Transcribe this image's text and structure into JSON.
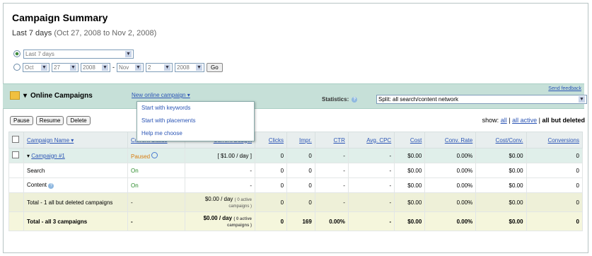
{
  "header": {
    "title": "Campaign Summary",
    "period": "Last 7 days",
    "range": "(Oct 27, 2008 to Nov 2, 2008)"
  },
  "date_filter": {
    "preset_value": "Last 7 days",
    "from_month": "Oct",
    "from_day": "27",
    "from_year": "2008",
    "to_month": "Nov",
    "to_day": "2",
    "to_year": "2008",
    "dash": "-",
    "go_label": "Go"
  },
  "campaigns_bar": {
    "label": "Online Campaigns",
    "new_campaign": "New online campaign ▾",
    "statistics_label": "Statistics:",
    "split_value": "Split: all search/content network",
    "feedback": "Send feedback"
  },
  "new_menu": {
    "items": [
      "Start with keywords",
      "Start with placements",
      "Help me choose"
    ]
  },
  "toolbar": {
    "pause": "Pause",
    "resume": "Resume",
    "delete": "Delete"
  },
  "show": {
    "label": "show:",
    "all": "all",
    "all_active": "all active",
    "all_but_deleted": "all but deleted",
    "sep": "|"
  },
  "table": {
    "headers": [
      "Campaign Name ▾",
      "Current Status",
      "Current Budget",
      "Clicks",
      "Impr.",
      "CTR",
      "Avg. CPC",
      "Cost",
      "Conv. Rate",
      "Cost/Conv.",
      "Conversions"
    ],
    "rows": [
      {
        "name": "Campaign #1",
        "status": "Paused",
        "budget": "[ $1.00 / day ]",
        "budget_sub": "",
        "clicks": "0",
        "impr": "0",
        "ctr": "-",
        "cpc": "-",
        "cost": "$0.00",
        "conv_rate": "0.00%",
        "cost_conv": "$0.00",
        "conversions": "0"
      },
      {
        "name": "Search",
        "status": "On",
        "budget": "-",
        "budget_sub": "",
        "clicks": "0",
        "impr": "0",
        "ctr": "-",
        "cpc": "-",
        "cost": "$0.00",
        "conv_rate": "0.00%",
        "cost_conv": "$0.00",
        "conversions": "0"
      },
      {
        "name": "Content",
        "status": "On",
        "budget": "-",
        "budget_sub": "",
        "clicks": "0",
        "impr": "0",
        "ctr": "-",
        "cpc": "-",
        "cost": "$0.00",
        "conv_rate": "0.00%",
        "cost_conv": "$0.00",
        "conversions": "0"
      },
      {
        "name": "Total - 1 all but deleted campaigns",
        "status": "-",
        "budget": "$0.00 / day",
        "budget_sub": "( 0 active campaigns )",
        "clicks": "0",
        "impr": "0",
        "ctr": "-",
        "cpc": "-",
        "cost": "$0.00",
        "conv_rate": "0.00%",
        "cost_conv": "$0.00",
        "conversions": "0"
      },
      {
        "name": "Total - all 3 campaigns",
        "status": "-",
        "budget": "$0.00 / day",
        "budget_sub": "( 0 active campaigns )",
        "clicks": "0",
        "impr": "169",
        "ctr": "0.00%",
        "cpc": "-",
        "cost": "$0.00",
        "conv_rate": "0.00%",
        "cost_conv": "$0.00",
        "conversions": "0"
      }
    ]
  }
}
